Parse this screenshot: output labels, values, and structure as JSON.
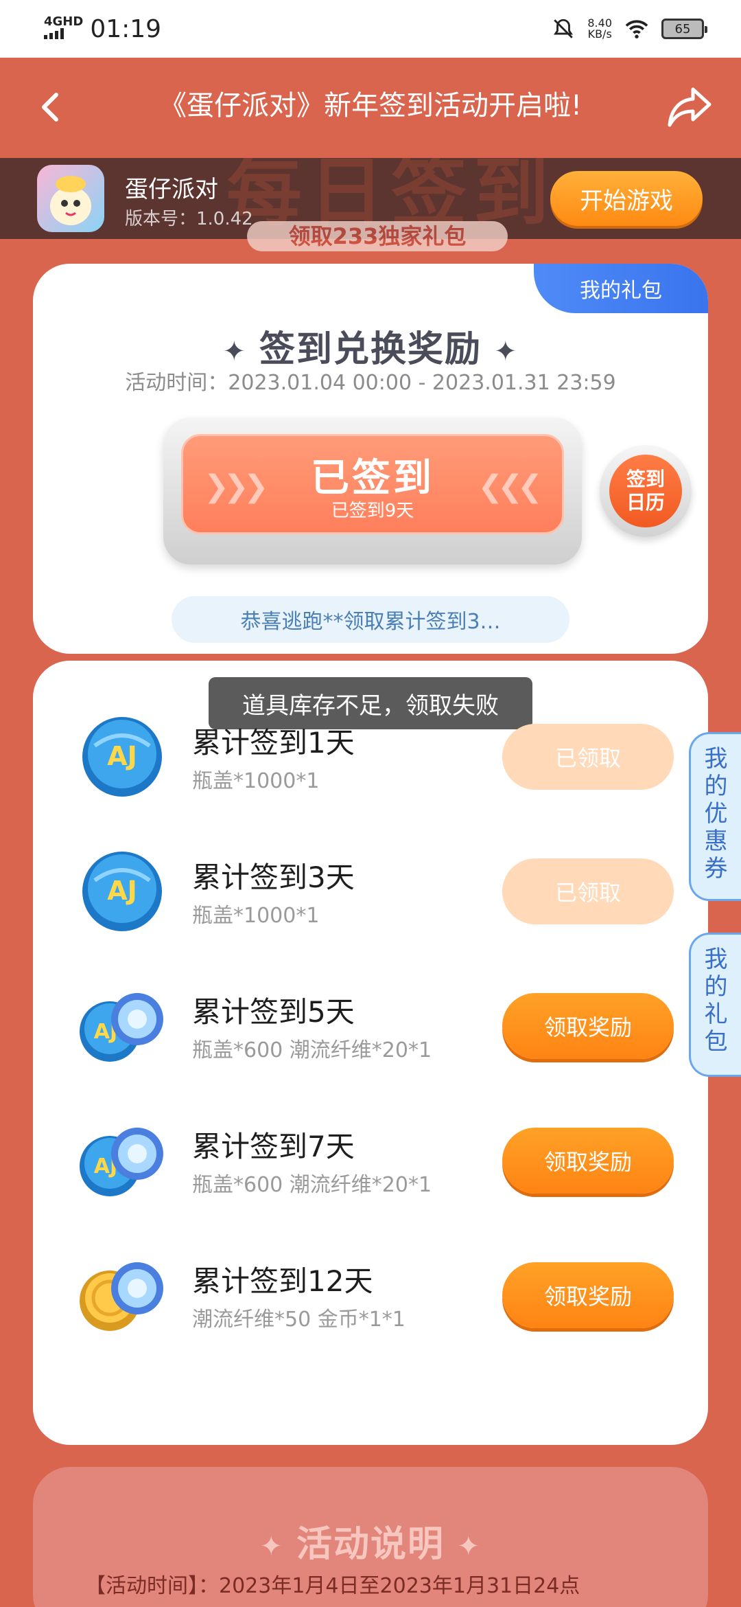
{
  "status_bar": {
    "network": "4GHD",
    "time": "01:19",
    "speed_value": "8.40",
    "speed_unit": "KB/s",
    "battery": "65"
  },
  "nav": {
    "title": "《蛋仔派对》新年签到活动开启啦!",
    "back_icon": "chevron-left-icon",
    "share_icon": "share-icon"
  },
  "game": {
    "name": "蛋仔派对",
    "version": "版本号：1.0.42",
    "play_label": "开始游戏",
    "banner_text": "每日签到",
    "banner_sub": "领取233独家礼包"
  },
  "signin": {
    "my_gift_tab": "我的礼包",
    "title": "签到兑换奖励",
    "time": "活动时间：2023.01.04 00:00 - 2023.01.31 23:59",
    "status_main": "已签到",
    "status_sub": "已签到9天",
    "calendar_line1": "签到",
    "calendar_line2": "日历",
    "notice": "恭喜逃跑**领取累计签到3…"
  },
  "toast": "道具库存不足，领取失败",
  "rewards": [
    {
      "title": "累计签到1天",
      "desc": "瓶盖*1000*1",
      "button": "已领取",
      "claimed": true,
      "icon": "bottle-cap-icon"
    },
    {
      "title": "累计签到3天",
      "desc": "瓶盖*1000*1",
      "button": "已领取",
      "claimed": true,
      "icon": "bottle-cap-icon"
    },
    {
      "title": "累计签到5天",
      "desc": "瓶盖*600 潮流纤维*20*1",
      "button": "领取奖励",
      "claimed": false,
      "icon": "cap-and-fiber-icon"
    },
    {
      "title": "累计签到7天",
      "desc": "瓶盖*600 潮流纤维*20*1",
      "button": "领取奖励",
      "claimed": false,
      "icon": "cap-and-fiber-icon"
    },
    {
      "title": "累计签到12天",
      "desc": "潮流纤维*50 金币*1*1",
      "button": "领取奖励",
      "claimed": false,
      "icon": "coin-and-fiber-icon"
    }
  ],
  "side_tabs": {
    "coupons": "我的优惠券",
    "gifts": "我的礼包"
  },
  "info": {
    "title": "活动说明",
    "time_text": "【活动时间】：2023年1月4日至2023年1月31日24点"
  },
  "colors": {
    "background": "#d9654f",
    "accent_orange": "#ff8a12",
    "claimed": "#ffd9b8",
    "blue": "#4f8bf7"
  }
}
